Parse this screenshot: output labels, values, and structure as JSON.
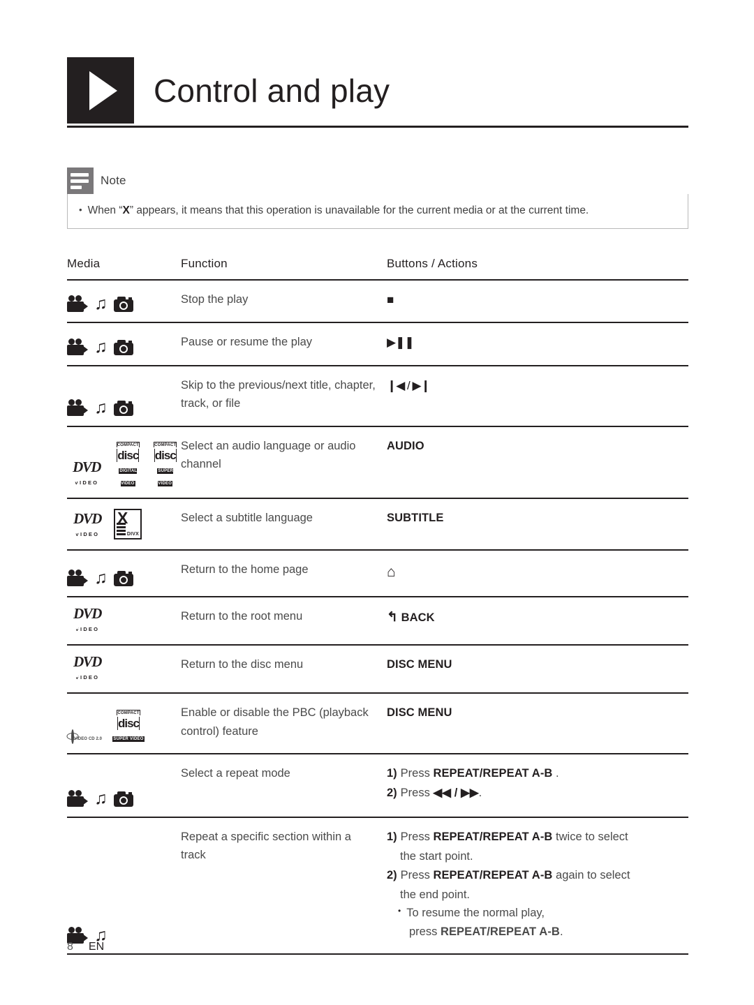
{
  "header": {
    "title": "Control and play",
    "badge_icon": "play-triangle-icon"
  },
  "note": {
    "label": "Note",
    "bullet": "•",
    "text_before": "When “",
    "x_symbol": "X",
    "text_after": "” appears, it means that this operation is unavailable for the current media or at the current time."
  },
  "table": {
    "headers": {
      "media": "Media",
      "function": "Function",
      "buttons": "Buttons / Actions"
    },
    "rows": [
      {
        "media_icons": [
          "video-camera-icon",
          "music-note-icon",
          "photo-camera-icon"
        ],
        "function": "Stop the play",
        "button_glyph": "■",
        "button_type": "glyph"
      },
      {
        "media_icons": [
          "video-camera-icon",
          "music-note-icon",
          "photo-camera-icon"
        ],
        "function": "Pause or resume the play",
        "button_glyph": "▶❚❚",
        "button_type": "glyph"
      },
      {
        "media_icons": [
          "video-camera-icon",
          "music-note-icon",
          "photo-camera-icon"
        ],
        "function": "Skip to the previous/next title, chapter, track, or file",
        "button_glyph": "❙◀ / ▶❙",
        "button_type": "glyph"
      },
      {
        "media_icons": [
          "dvd-video-logo",
          "compact-disc-digital-video-logo",
          "compact-disc-super-video-logo"
        ],
        "function": "Select an audio language or audio channel",
        "button_label": "AUDIO",
        "button_type": "label"
      },
      {
        "media_icons": [
          "dvd-video-logo",
          "divx-logo"
        ],
        "function": "Select a subtitle language",
        "button_label": "SUBTITLE",
        "button_type": "label"
      },
      {
        "media_icons": [
          "video-camera-icon",
          "music-note-icon",
          "photo-camera-icon"
        ],
        "function": "Return to the home page",
        "button_glyph": "⌂",
        "button_type": "home"
      },
      {
        "media_icons": [
          "dvd-video-logo"
        ],
        "function": "Return to the root menu",
        "button_label": "BACK",
        "button_prefix_glyph": "↰",
        "button_type": "back"
      },
      {
        "media_icons": [
          "dvd-video-logo"
        ],
        "function": "Return to the disc menu",
        "button_label": "DISC MENU",
        "button_type": "label"
      },
      {
        "media_icons": [
          "video-cd-2-0-logo",
          "compact-disc-super-video-logo"
        ],
        "function": "Enable or disable the PBC (playback control) feature",
        "button_label": "DISC MENU",
        "button_type": "label"
      },
      {
        "media_icons": [
          "video-camera-icon",
          "music-note-icon",
          "photo-camera-icon"
        ],
        "function": "Select a repeat mode",
        "button_type": "steps",
        "steps": [
          {
            "num": "1)",
            "pre": "Press ",
            "strong": "REPEAT/REPEAT A-B",
            "post": " ."
          },
          {
            "num": "2)",
            "pre": "Press ",
            "strong": "◀◀ / ▶▶",
            "post": "."
          }
        ]
      },
      {
        "media_icons": [
          "video-camera-icon",
          "music-note-icon"
        ],
        "function": "Repeat a specific section within a track",
        "button_type": "steps-long",
        "steps": [
          {
            "num": "1)",
            "pre": "Press ",
            "strong": "REPEAT/REPEAT A-B",
            "post": "  twice to select",
            "cont": "the start point."
          },
          {
            "num": "2)",
            "pre": "Press ",
            "strong": "REPEAT/REPEAT A-B",
            "post": "  again to select",
            "cont": "the end point."
          }
        ],
        "sub_bullet": {
          "dot": "•",
          "line1": "To resume the normal play,",
          "line2_pre": "press ",
          "line2_strong": "REPEAT/REPEAT A-B",
          "line2_post": "."
        }
      }
    ]
  },
  "footer": {
    "page_number": "8",
    "language": "EN"
  },
  "logos": {
    "dvd_word": "DVD",
    "dvd_video": "VIDEO",
    "cd_compact": "COMPACT",
    "cd_disc": "disc",
    "cd_digital_video": "DIGITAL VIDEO",
    "cd_super_video": "SUPER VIDEO",
    "divx_word": "DIVX",
    "divx_x": "X",
    "vcd_caption": "VIDEO CD 2.0"
  },
  "colors": {
    "ink": "#231f20",
    "body_text": "#4a4a4a",
    "note_gray": "#7a787a",
    "rule": "#231f20"
  }
}
